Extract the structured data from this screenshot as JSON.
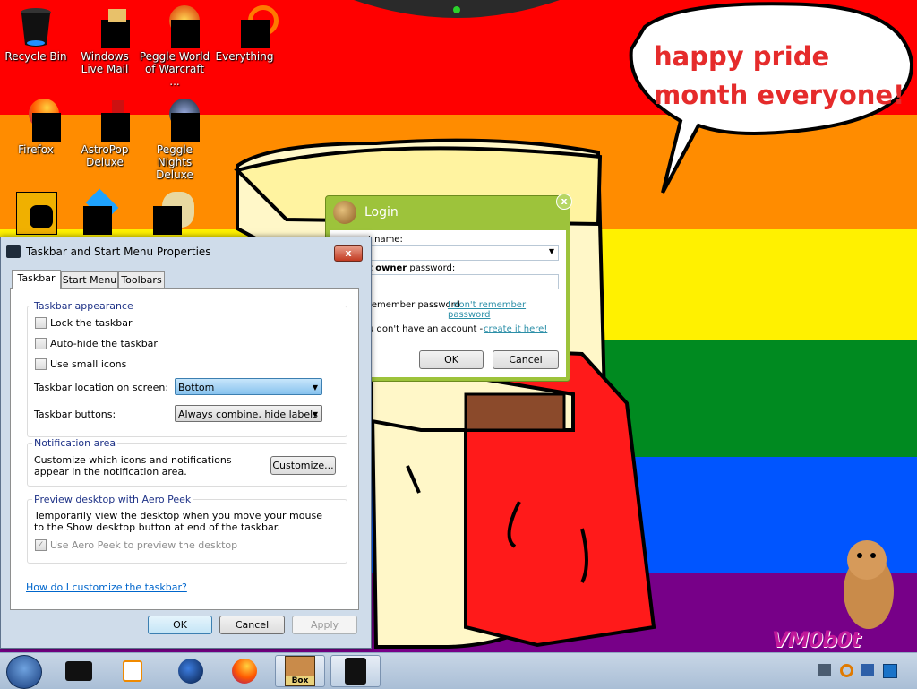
{
  "wallpaper": {
    "speech_bubble": "happy pride month everyone!",
    "watermark": "VM0b0t",
    "colors": {
      "red": "#ff0000",
      "orange": "#ff8c00",
      "yellow": "#fff100",
      "green": "#008a20",
      "blue": "#0055ff",
      "purple": "#770088"
    }
  },
  "desktop_icons": [
    {
      "label": "Recycle Bin",
      "icon": "recycle-bin-icon"
    },
    {
      "label": "Windows Live Mail",
      "icon": "mail-icon"
    },
    {
      "label": "Peggle World of Warcraft ...",
      "icon": "peggle-icon"
    },
    {
      "label": "Everything",
      "icon": "search-icon"
    },
    {
      "label": "Firefox",
      "icon": "firefox-icon"
    },
    {
      "label": "AstroPop Deluxe",
      "icon": "astropop-icon"
    },
    {
      "label": "Peggle Nights Deluxe",
      "icon": "peggle-nights-icon"
    }
  ],
  "taskbar_dialog": {
    "title": "Taskbar and Start Menu Properties",
    "close": "x",
    "tabs": [
      "Taskbar",
      "Start Menu",
      "Toolbars"
    ],
    "appearance_group": "Taskbar appearance",
    "lock_label": "Lock the taskbar",
    "autohide_label": "Auto-hide the taskbar",
    "small_icons_label": "Use small icons",
    "location_label": "Taskbar location on screen:",
    "location_value": "Bottom",
    "buttons_label": "Taskbar buttons:",
    "buttons_value": "Always combine, hide labels",
    "notification_group": "Notification area",
    "notification_text": "Customize which icons and notifications appear in the notification area.",
    "customize_btn": "Customize...",
    "peek_group": "Preview desktop with Aero Peek",
    "peek_text": "Temporarily view the desktop when you move your mouse to the Show desktop button at end of the taskbar.",
    "peek_check_label": "Use Aero Peek to preview the desktop",
    "help_link": "How do I customize the taskbar?",
    "ok": "OK",
    "cancel": "Cancel",
    "apply": "Apply"
  },
  "login_dialog": {
    "title": "Login",
    "close": "x",
    "name_label": "t name:",
    "password_label_bold": "t owner",
    "password_label_rest": " password:",
    "remember_label": "remember password",
    "forgot_link": "I don't remember password",
    "account_text": "u don't have an account -",
    "create_link": "create it here!",
    "ok": "OK",
    "cancel": "Cancel"
  },
  "taskbar": {
    "items": [
      "mycomputer-icon",
      "media-player-icon",
      "globe-icon",
      "firefox-icon",
      "box-app-icon",
      "recycle-bin-icon"
    ],
    "active_label": "Box"
  }
}
